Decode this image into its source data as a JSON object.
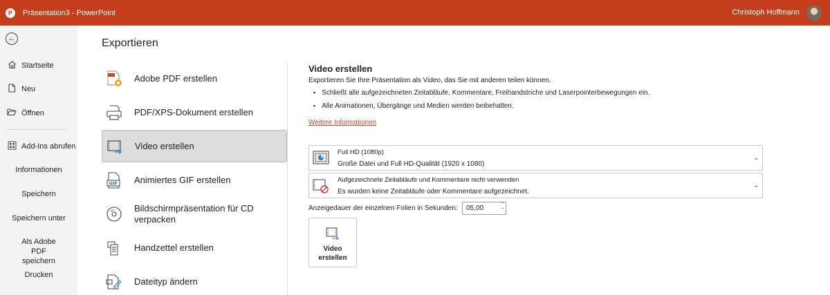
{
  "titlebar": {
    "title": "Präsentation3  -  PowerPoint",
    "user_name": "Christoph Hoffmann",
    "accent_color": "#c43e1c"
  },
  "sidebar": {
    "items": [
      {
        "label": "Startseite",
        "icon": "home-icon"
      },
      {
        "label": "Neu",
        "icon": "new-document-icon"
      },
      {
        "label": "Öffnen",
        "icon": "folder-open-icon"
      },
      {
        "label": "Add-Ins abrufen",
        "icon": "addins-grid-icon"
      },
      {
        "label": "Informationen"
      },
      {
        "label": "Speichern"
      },
      {
        "label": "Speichern unter"
      },
      {
        "label": "Als Adobe PDF speichern"
      },
      {
        "label": "Drucken"
      }
    ]
  },
  "main": {
    "title": "Exportieren",
    "export_items": [
      {
        "label": "Adobe PDF erstellen",
        "icon": "adobe-pdf-icon"
      },
      {
        "label": "PDF/XPS-Dokument erstellen",
        "icon": "pdf-xps-icon"
      },
      {
        "label": "Video erstellen",
        "icon": "video-icon",
        "selected": true
      },
      {
        "label": "Animiertes GIF erstellen",
        "icon": "gif-icon"
      },
      {
        "label": "Bildschirmpräsentation für CD verpacken",
        "icon": "cd-icon"
      },
      {
        "label": "Handzettel erstellen",
        "icon": "handout-icon"
      },
      {
        "label": "Dateityp ändern",
        "icon": "change-filetype-icon"
      }
    ]
  },
  "panel": {
    "title": "Video erstellen",
    "description": "Exportieren Sie Ihre Präsentation als Video, das Sie mit anderen teilen können.",
    "bullets": [
      "Schließt alle aufgezeichneten Zeitabläufe, Kommentare, Freihandstriche und Laserpointerbewegungen ein.",
      "Alle Animationen, Übergänge und Medien werden beibehalten."
    ],
    "link": "Weitere Informationen",
    "quality_dropdown": {
      "main": "Full HD (1080p)",
      "sub": "Große Datei und Full HD-Qualität (1920 x 1080)"
    },
    "timing_dropdown": {
      "main": "Aufgezeichnete Zeitabläufe und Kommentare nicht verwenden",
      "sub": "Es wurden keine Zeitabläufe oder Kommentare aufgezeichnet."
    },
    "duration_label": "Anzeigedauer der einzelnen Folien in Sekunden:",
    "duration_value": "05,00",
    "create_button": "Video erstellen"
  }
}
